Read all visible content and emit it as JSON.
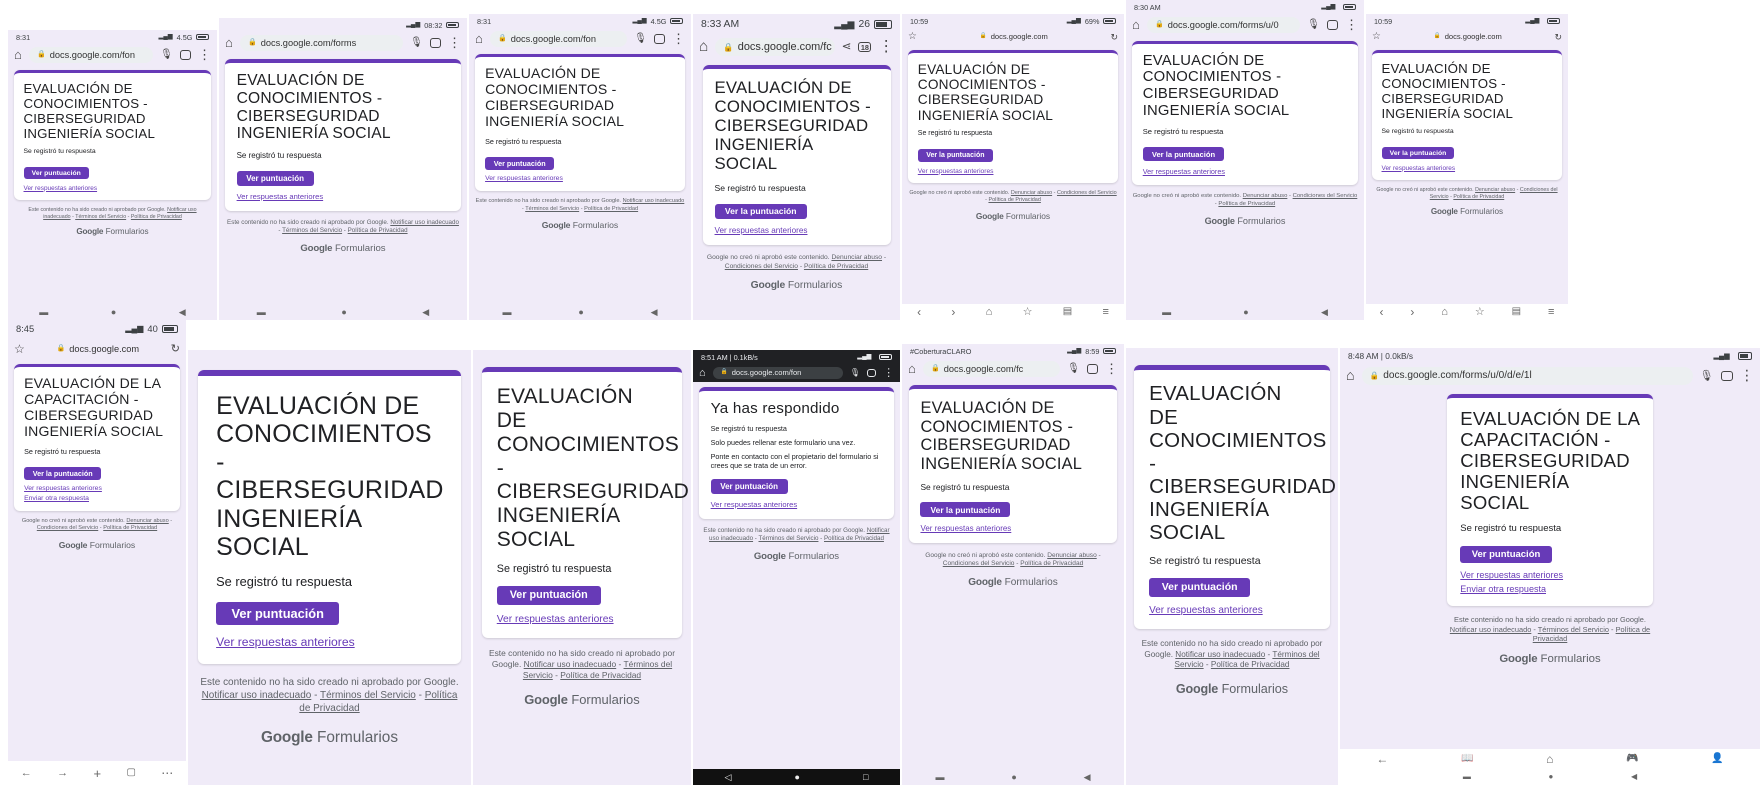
{
  "colors": {
    "accent": "#673ab7",
    "background": "#f0ebf8",
    "card": "#ffffff",
    "link": "#673ab7",
    "status_dark": "#202124"
  },
  "common": {
    "title_conocimientos": "EVALUACIÓN DE CONOCIMIENTOS - CIBERSEGURIDAD INGENIERÍA SOCIAL",
    "title_capacitacion": "EVALUACIÓN DE LA CAPACITACIÓN - CIBERSEGURIDAD INGENIERÍA SOCIAL",
    "registered": "Se registró tu respuesta",
    "btn_ver_puntuacion": "Ver puntuación",
    "btn_ver_la_puntuacion": "Ver la puntuación",
    "link_previous": "Ver respuestas anteriores",
    "link_other": "Enviar otra respuesta",
    "footer_es_lead": "Este contenido no ha sido creado ni aprobado por Google.",
    "footer_es_report": "Notificar uso inadecuado",
    "footer_es_terms": "Términos del Servicio",
    "footer_es_privacy": "Política de Privacidad",
    "footer_la_lead": "Google no creó ni aprobó este contenido.",
    "footer_la_report": "Denunciar abuso",
    "footer_la_terms": "Condiciones del Servicio",
    "footer_la_privacy": "Política de Privacidad",
    "brand_google": "Google",
    "brand_forms": "Formularios",
    "already_title": "Ya has respondido",
    "already_once": "Solo puedes rellenar este formulario una vez.",
    "already_contact": "Ponte en contacto con el propietario del formulario si crees que se trata de un error."
  },
  "screens": [
    {
      "status": {
        "time": "8:31",
        "right": "4.5G"
      },
      "url": "docs.google.com/fon"
    },
    {
      "status": {
        "time": "",
        "right": "08:32"
      },
      "url": "docs.google.com/forms"
    },
    {
      "status": {
        "time": "8:31",
        "right": "4.5G"
      },
      "url": "docs.google.com/fon"
    },
    {
      "status": {
        "time": "8:33 AM",
        "right": "26"
      },
      "url": "docs.google.com/fc",
      "tabs": "18"
    },
    {
      "status": {
        "time": "10:59",
        "right": "69%"
      },
      "url": "docs.google.com"
    },
    {
      "status": {
        "time": "8:30 AM",
        "right": ""
      },
      "url": "docs.google.com/forms/u/0"
    },
    {
      "status": {
        "time": "10:59",
        "right": ""
      },
      "url": "docs.google.com"
    },
    {
      "status": {
        "time": "8:45",
        "right": "40"
      },
      "url": "docs.google.com"
    },
    {
      "status": {
        "time": "",
        "right": ""
      },
      "url": ""
    },
    {
      "status": {
        "time": "",
        "right": ""
      },
      "url": ""
    },
    {
      "status": {
        "time": "8:51 AM | 0.1kB/s",
        "right": ""
      },
      "url": "docs.google.com/fon"
    },
    {
      "status": {
        "time": "#CoberturaCLARO",
        "right": "8:59"
      },
      "url": "docs.google.com/fc"
    },
    {
      "status": {
        "time": "",
        "right": ""
      },
      "url": ""
    },
    {
      "status": {
        "time": "8:48 AM | 0.0kB/s",
        "right": ""
      },
      "url": "docs.google.com/forms/u/0/d/e/1l"
    }
  ]
}
